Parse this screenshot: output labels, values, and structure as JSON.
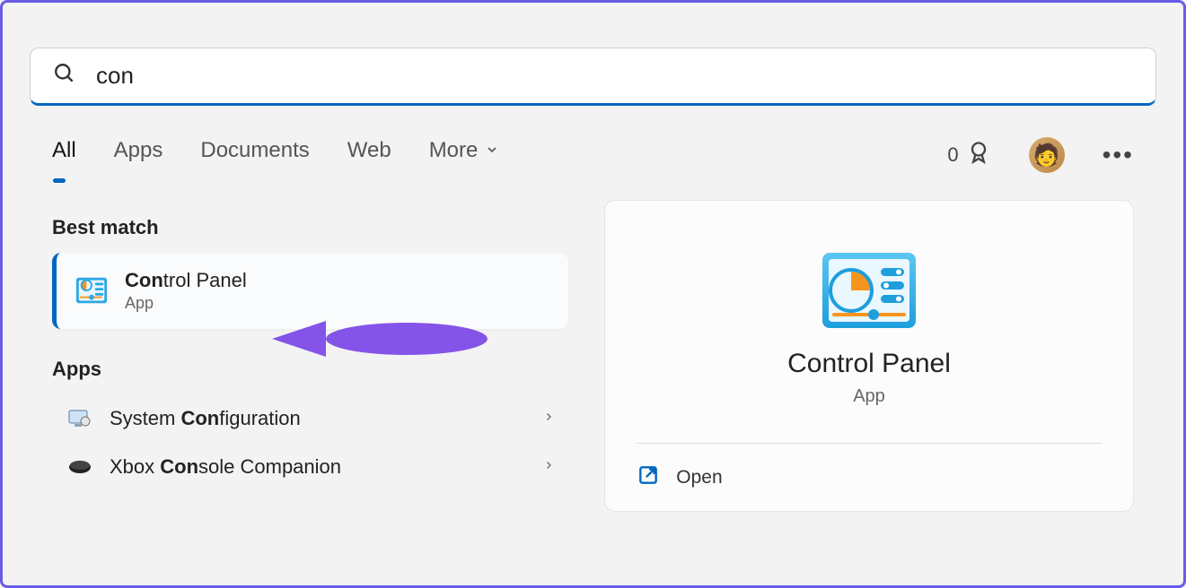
{
  "search": {
    "value": "con"
  },
  "tabs": {
    "all": "All",
    "apps": "Apps",
    "documents": "Documents",
    "web": "Web",
    "more": "More"
  },
  "points": {
    "count": "0"
  },
  "sections": {
    "best_match": "Best match",
    "apps": "Apps"
  },
  "results": {
    "best": {
      "prefix": "Con",
      "rest": "trol Panel",
      "subtitle": "App"
    },
    "apps": [
      {
        "pre": "System ",
        "bold": "Con",
        "post": "figuration"
      },
      {
        "pre": "Xbox ",
        "bold": "Con",
        "post": "sole Companion"
      }
    ]
  },
  "detail": {
    "title": "Control Panel",
    "subtitle": "App",
    "open": "Open"
  }
}
